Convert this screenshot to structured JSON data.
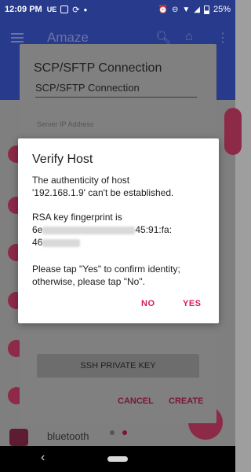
{
  "status_bar": {
    "time": "12:09 PM",
    "left_icons": [
      "ue-icon",
      "notification-icon",
      "sync-icon",
      "dot-icon"
    ],
    "right_icons": [
      "alarm-icon",
      "dnd-icon",
      "wifi-icon",
      "signal-icon",
      "battery-icon"
    ],
    "battery": "25%"
  },
  "app_bar": {
    "title": "Amaze",
    "icons": [
      "menu-icon",
      "search-icon",
      "home-icon",
      "more-icon"
    ]
  },
  "background_list": {
    "visible_item": "bluetooth"
  },
  "connection_dialog": {
    "title": "SCP/SFTP Connection",
    "connection_name_value": "SCP/SFTP Connection",
    "server_ip_hint": "Server IP Address",
    "ssh_key_button": "SSH PRIVATE KEY",
    "cancel_label": "CANCEL",
    "create_label": "CREATE"
  },
  "verify_dialog": {
    "title": "Verify Host",
    "message_line1": "The authenticity of host",
    "message_line2": "'192.168.1.9' can't be established.",
    "fingerprint_label": "RSA key fingerprint is",
    "fingerprint_line1_start": "6e",
    "fingerprint_line1_end": "45:91:fa:",
    "fingerprint_line2_start": "46",
    "confirm_text": "Please tap \"Yes\" to confirm identity; otherwise, please tap \"No\".",
    "no_label": "NO",
    "yes_label": "YES",
    "accent_color": "#d81b60"
  },
  "colors": {
    "primary": "#283a8c",
    "accent": "#d81b60"
  }
}
